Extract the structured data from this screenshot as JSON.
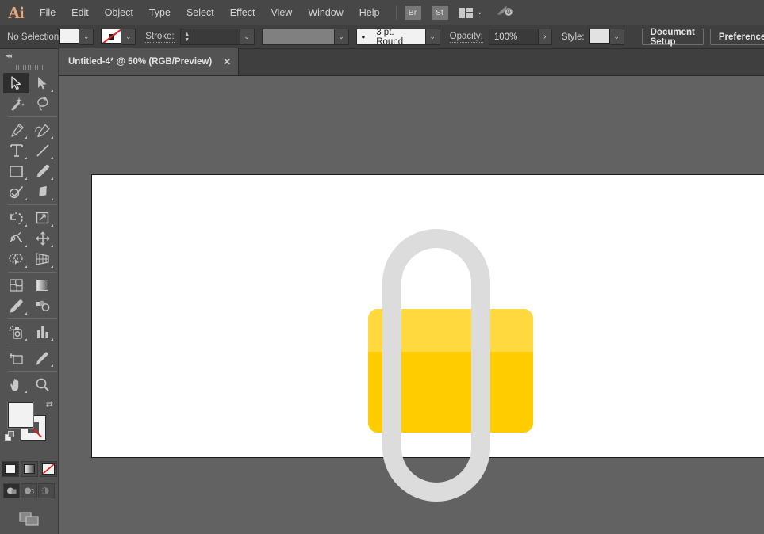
{
  "app": {
    "logo": "Ai",
    "menus": [
      "File",
      "Edit",
      "Object",
      "Type",
      "Select",
      "Effect",
      "View",
      "Window",
      "Help"
    ],
    "quick_apps": [
      {
        "name": "bridge-button",
        "label": "Br"
      },
      {
        "name": "stock-button",
        "label": "St"
      }
    ],
    "arrange_documents_icon": "arrange-documents-icon",
    "arrange_chevron": "⌄",
    "workspace_switcher_icon": "rocket-icon"
  },
  "control_bar": {
    "selection_status": "No Selection",
    "fill_label": "fill-swatch",
    "fill_color": "#F2F2F2",
    "stroke_swatch_label": "stroke-swatch-none",
    "stroke_label": "Stroke:",
    "stroke_weight": "",
    "variable_width_profile": "",
    "brush_definition": "3 pt. Round",
    "brush_bullet": "•",
    "opacity_label": "Opacity:",
    "opacity_value": "100%",
    "opacity_more": "›",
    "style_label": "Style:",
    "style_swatch_color": "#E2E2E2",
    "document_setup": "Document Setup",
    "preferences": "Preferences",
    "align_icon": "align-to-selection-icon",
    "align_chevron": "⌄",
    "dropdown_glyph": "⌄",
    "stepper_up": "▲",
    "stepper_down": "▼"
  },
  "tab_bar": {
    "tabs": [
      {
        "title": "Untitled-4* @ 50% (RGB/Preview)",
        "close": "✕",
        "active": true
      }
    ]
  },
  "toolbar": {
    "collapse_glyph": "◂◂",
    "tools": [
      {
        "name": "selection-tool",
        "active": true,
        "has_flyout": false
      },
      {
        "name": "direct-selection-tool",
        "active": false,
        "has_flyout": true
      },
      {
        "name": "magic-wand-tool",
        "active": false,
        "has_flyout": false
      },
      {
        "name": "lasso-tool",
        "active": false,
        "has_flyout": false
      },
      {
        "name": "pen-tool",
        "active": false,
        "has_flyout": true
      },
      {
        "name": "curvature-tool",
        "active": false,
        "has_flyout": true
      },
      {
        "name": "type-tool",
        "active": false,
        "has_flyout": true
      },
      {
        "name": "line-segment-tool",
        "active": false,
        "has_flyout": true
      },
      {
        "name": "rectangle-tool",
        "active": false,
        "has_flyout": true
      },
      {
        "name": "paintbrush-tool",
        "active": false,
        "has_flyout": true
      },
      {
        "name": "shaper-tool",
        "active": false,
        "has_flyout": true
      },
      {
        "name": "eraser-tool",
        "active": false,
        "has_flyout": true
      },
      {
        "name": "rotate-tool",
        "active": false,
        "has_flyout": true
      },
      {
        "name": "scale-tool",
        "active": false,
        "has_flyout": true
      },
      {
        "name": "width-tool",
        "active": false,
        "has_flyout": true
      },
      {
        "name": "free-transform-tool",
        "active": false,
        "has_flyout": true
      },
      {
        "name": "shape-builder-tool",
        "active": false,
        "has_flyout": true
      },
      {
        "name": "perspective-grid-tool",
        "active": false,
        "has_flyout": true
      },
      {
        "name": "mesh-tool",
        "active": false,
        "has_flyout": false
      },
      {
        "name": "gradient-tool",
        "active": false,
        "has_flyout": false
      },
      {
        "name": "eyedropper-tool",
        "active": false,
        "has_flyout": true
      },
      {
        "name": "blend-tool",
        "active": false,
        "has_flyout": false
      },
      {
        "name": "symbol-sprayer-tool",
        "active": false,
        "has_flyout": true
      },
      {
        "name": "column-graph-tool",
        "active": false,
        "has_flyout": true
      },
      {
        "name": "artboard-tool",
        "active": false,
        "has_flyout": false
      },
      {
        "name": "slice-tool",
        "active": false,
        "has_flyout": true
      },
      {
        "name": "hand-tool",
        "active": false,
        "has_flyout": true
      },
      {
        "name": "zoom-tool",
        "active": false,
        "has_flyout": false
      }
    ],
    "fill_color": "#F2F2F2",
    "stroke_color": "none",
    "swap_glyph": "⇄",
    "color_modes": [
      {
        "name": "color-button",
        "selected": true
      },
      {
        "name": "gradient-button",
        "selected": false
      },
      {
        "name": "none-button",
        "selected": false
      }
    ],
    "draw_modes": [
      {
        "name": "draw-normal-button",
        "selected": true
      },
      {
        "name": "draw-behind-button",
        "selected": false
      },
      {
        "name": "draw-inside-button",
        "selected": false
      }
    ],
    "screen_mode": "change-screen-mode-icon"
  },
  "canvas": {
    "background_color": "#626262",
    "artboard_color": "#FFFFFF",
    "artwork": {
      "name": "padlock-illustration",
      "shackle_color": "#DCDCDC",
      "body_color": "#FFCC00",
      "body_highlight_color": "#FFD93D"
    }
  }
}
